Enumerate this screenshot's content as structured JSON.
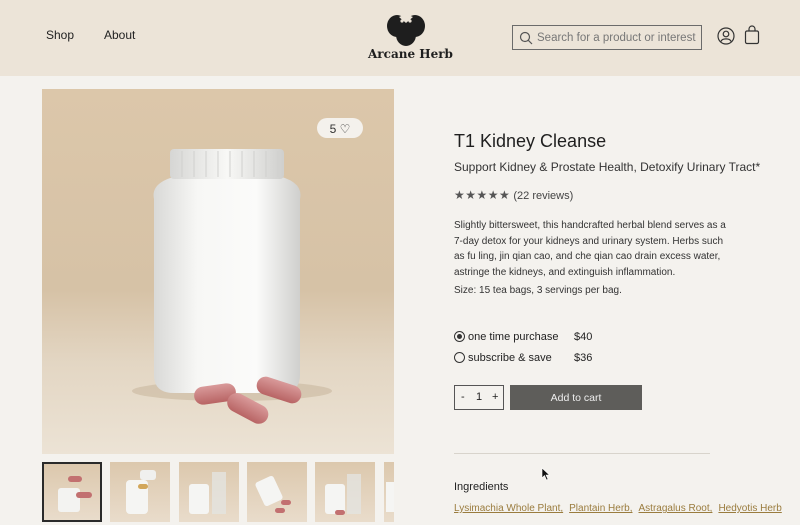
{
  "header": {
    "nav": [
      "Shop",
      "About"
    ],
    "brand": "Arcane Herb",
    "search_placeholder": "Search for a product or interest"
  },
  "product": {
    "wishlist_count": "5",
    "title": "T1 Kidney Cleanse",
    "subtitle": "Support Kidney & Prostate Health, Detoxify Urinary Tract*",
    "stars": "★★★★★",
    "reviews": "(22 reviews)",
    "description": "Slightly bittersweet, this handcrafted herbal blend serves as a 7-day detox for your kidneys and urinary system. Herbs such as fu ling, jin qian cao, and che qian cao drain excess water, astringe the kidneys, and extinguish inflammation.",
    "size": "Size: 15 tea bags, 3 servings per bag.",
    "options": [
      {
        "label": "one time purchase",
        "price": "$40",
        "selected": true
      },
      {
        "label": "subscribe & save",
        "price": "$36",
        "selected": false
      }
    ],
    "quantity": "1",
    "qty_minus": "-",
    "qty_plus": "+",
    "add_to_cart": "Add to cart",
    "ingredients_title": "Ingredients",
    "ingredients": [
      "Lysimachia Whole Plant,",
      "Plantain Herb,",
      "Astragalus Root,",
      "Hedyotis Herb"
    ]
  }
}
